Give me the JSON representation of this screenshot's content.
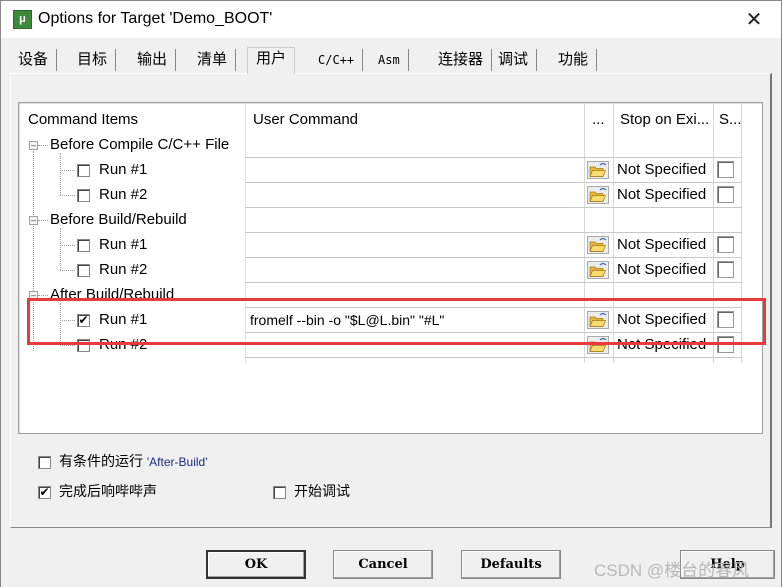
{
  "window": {
    "title": "Options for Target 'Demo_BOOT'",
    "icon": "uvision-icon",
    "close_glyph": "✕"
  },
  "tabs": [
    {
      "label": "设备",
      "active": false
    },
    {
      "label": "目标",
      "active": false
    },
    {
      "label": "输出",
      "active": false
    },
    {
      "label": "清单",
      "active": false
    },
    {
      "label": "用户",
      "active": true
    },
    {
      "label": "C/C++",
      "active": false
    },
    {
      "label": "Asm",
      "active": false
    },
    {
      "label": "连接器",
      "active": false
    },
    {
      "label": "调试",
      "active": false
    },
    {
      "label": "功能",
      "active": false
    }
  ],
  "grid": {
    "headers": {
      "items": "Command Items",
      "command": "User Command",
      "browse": "...",
      "stop": "Stop on Exi...",
      "s": "S..."
    },
    "groups": [
      {
        "label": "Before Compile C/C++ File",
        "expander": "⊟",
        "runs": [
          {
            "label": "Run #1",
            "checked": false,
            "command": "",
            "stop": "Not Specified",
            "s_checked": false
          },
          {
            "label": "Run #2",
            "checked": false,
            "command": "",
            "stop": "Not Specified",
            "s_checked": false
          }
        ]
      },
      {
        "label": "Before Build/Rebuild",
        "expander": "⊟",
        "runs": [
          {
            "label": "Run #1",
            "checked": false,
            "command": "",
            "stop": "Not Specified",
            "s_checked": false
          },
          {
            "label": "Run #2",
            "checked": false,
            "command": "",
            "stop": "Not Specified",
            "s_checked": false
          }
        ]
      },
      {
        "label": "After Build/Rebuild",
        "expander": "⊟",
        "runs": [
          {
            "label": "Run #1",
            "checked": true,
            "command": "fromelf --bin -o \"$L@L.bin\" \"#L\"",
            "stop": "Not Specified",
            "s_checked": false
          },
          {
            "label": "Run #2",
            "checked": false,
            "command": "",
            "stop": "Not Specified",
            "s_checked": false
          }
        ]
      }
    ],
    "check_glyph": "✔"
  },
  "options": {
    "conditional_run": {
      "label": "有条件的运行",
      "quoted": "'After-Build'",
      "checked": false
    },
    "beep": {
      "label": "完成后响哔哔声",
      "checked": true
    },
    "start_debug": {
      "label": "开始调试",
      "checked": false
    }
  },
  "buttons": {
    "ok": "OK",
    "cancel": "Cancel",
    "defaults": "Defaults",
    "help": "Help"
  },
  "annotation": {
    "color": "#e83a3a"
  },
  "watermark": "CSDN @楼台的春风"
}
